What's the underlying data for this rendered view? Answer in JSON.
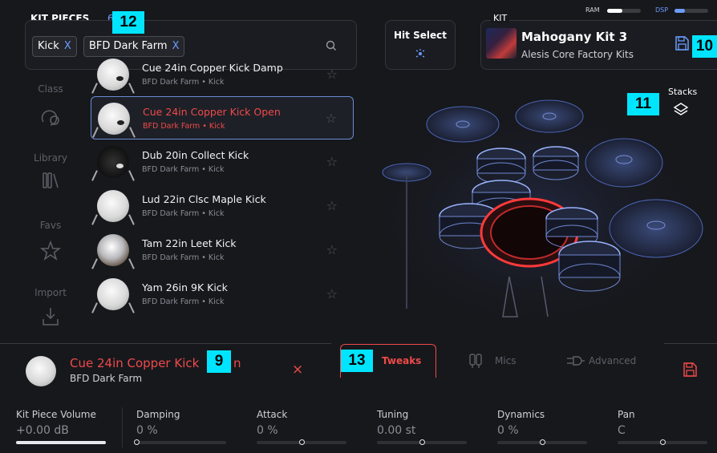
{
  "browser": {
    "title": "KIT PIECES",
    "count": "6",
    "filters": [
      {
        "label": "Kick",
        "remove": "X"
      },
      {
        "label": "BFD Dark Farm",
        "remove": "X"
      }
    ]
  },
  "categories": [
    {
      "label": "Class",
      "icon": "class-icon"
    },
    {
      "label": "Library",
      "icon": "library-icon"
    },
    {
      "label": "Favs",
      "icon": "star-icon"
    },
    {
      "label": "Import",
      "icon": "import-icon"
    }
  ],
  "kit_pieces": [
    {
      "name": "Cue 24in Copper Kick Damp",
      "sub": "BFD Dark Farm • Kick",
      "thumb": "white"
    },
    {
      "name": "Cue 24in Copper Kick Open",
      "sub": "BFD Dark Farm • Kick",
      "thumb": "white",
      "selected": true
    },
    {
      "name": "Dub 20in Collect Kick",
      "sub": "BFD Dark Farm • Kick",
      "thumb": "dark"
    },
    {
      "name": "Lud 22in Clsc Maple Kick",
      "sub": "BFD Dark Farm • Kick",
      "thumb": "white"
    },
    {
      "name": "Tam 22in Leet Kick",
      "sub": "BFD Dark Farm • Kick",
      "thumb": "chrome"
    },
    {
      "name": "Yam 26in 9K Kick",
      "sub": "BFD Dark Farm • Kick",
      "thumb": "white"
    }
  ],
  "hit_select": {
    "label": "Hit Select"
  },
  "kit": {
    "section": "KIT",
    "name": "Mahogany Kit 3",
    "library": "Alesis Core Factory Kits"
  },
  "meters": {
    "ram_label": "RAM",
    "ram_level": 0.45,
    "dsp_label": "DSP",
    "dsp_level": 0.3
  },
  "stacks": {
    "label": "Stacks"
  },
  "selected_piece": {
    "name": "Cue 24in Copper Kick",
    "name_tail": "n",
    "library": "BFD Dark Farm",
    "close": "×"
  },
  "tabs": [
    {
      "label": "Tweaks",
      "active": true
    },
    {
      "label": "Mics",
      "active": false
    },
    {
      "label": "Advanced",
      "active": false
    }
  ],
  "params": [
    {
      "label": "Kit Piece Volume",
      "value": "+0.00 dB",
      "level": 1.0
    },
    {
      "label": "Damping",
      "value": "0 %",
      "level": 0.0
    },
    {
      "label": "Attack",
      "value": "0 %",
      "level": 0.5
    },
    {
      "label": "Tuning",
      "value": "0.00 st",
      "level": 0.5
    },
    {
      "label": "Dynamics",
      "value": "0 %",
      "level": 0.5
    },
    {
      "label": "Pan",
      "value": "C",
      "level": 0.5
    }
  ],
  "callouts": {
    "c9": "9",
    "c10": "10",
    "c11": "11",
    "c12": "12",
    "c13": "13"
  },
  "colors": {
    "accent_red": "#ef4a4a",
    "accent_blue": "#6b9cff",
    "callout": "#00e5ff"
  }
}
